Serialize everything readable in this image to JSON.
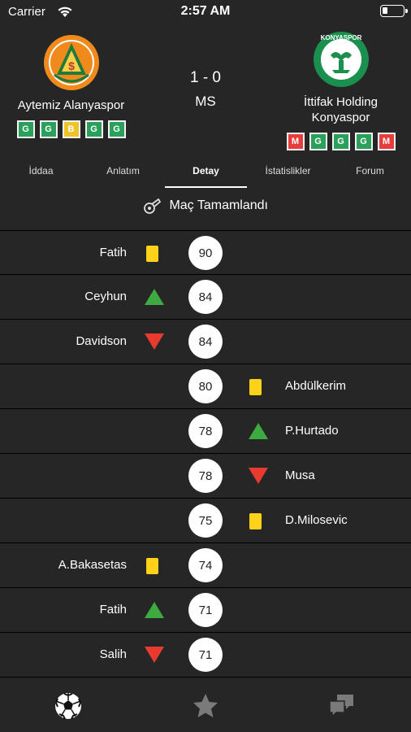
{
  "status_bar": {
    "carrier": "Carrier",
    "time": "2:57 AM"
  },
  "match": {
    "home": {
      "name": "Aytemiz Alanyaspor",
      "form": [
        "G",
        "G",
        "B",
        "G",
        "G"
      ]
    },
    "away": {
      "name_line1": "İttifak Holding",
      "name_line2": "Konyaspor",
      "crest_text": "KONYASPOR",
      "form": [
        "M",
        "G",
        "G",
        "G",
        "M"
      ]
    },
    "score": "1 - 0",
    "status": "MS"
  },
  "tabs": [
    "İddaa",
    "Anlatım",
    "Detay",
    "İstatislikler",
    "Forum"
  ],
  "active_tab": "Detay",
  "finished_label": "Maç Tamamlandı",
  "events": [
    {
      "side": "home",
      "minute": "90",
      "player": "Fatih",
      "type": "yellow-card"
    },
    {
      "side": "home",
      "minute": "84",
      "player": "Ceyhun",
      "type": "sub-in"
    },
    {
      "side": "home",
      "minute": "84",
      "player": "Davidson",
      "type": "sub-out"
    },
    {
      "side": "away",
      "minute": "80",
      "player": "Abdülkerim",
      "type": "yellow-card"
    },
    {
      "side": "away",
      "minute": "78",
      "player": "P.Hurtado",
      "type": "sub-in"
    },
    {
      "side": "away",
      "minute": "78",
      "player": "Musa",
      "type": "sub-out"
    },
    {
      "side": "away",
      "minute": "75",
      "player": "D.Milosevic",
      "type": "yellow-card"
    },
    {
      "side": "home",
      "minute": "74",
      "player": "A.Bakasetas",
      "type": "yellow-card"
    },
    {
      "side": "home",
      "minute": "71",
      "player": "Fatih",
      "type": "sub-in"
    },
    {
      "side": "home",
      "minute": "71",
      "player": "Salih",
      "type": "sub-out"
    }
  ],
  "bottom_nav": [
    {
      "icon": "soccer-ball-icon",
      "active": true
    },
    {
      "icon": "star-icon",
      "active": false
    },
    {
      "icon": "chat-bubbles-icon",
      "active": false
    }
  ],
  "colors": {
    "background": "#262626",
    "yellow_card": "#ffd21a",
    "sub_in": "#3dab3f",
    "sub_out": "#e83a2e",
    "form_win": "#2aa05a",
    "form_draw": "#f0c32a",
    "form_loss": "#e53c3c"
  }
}
